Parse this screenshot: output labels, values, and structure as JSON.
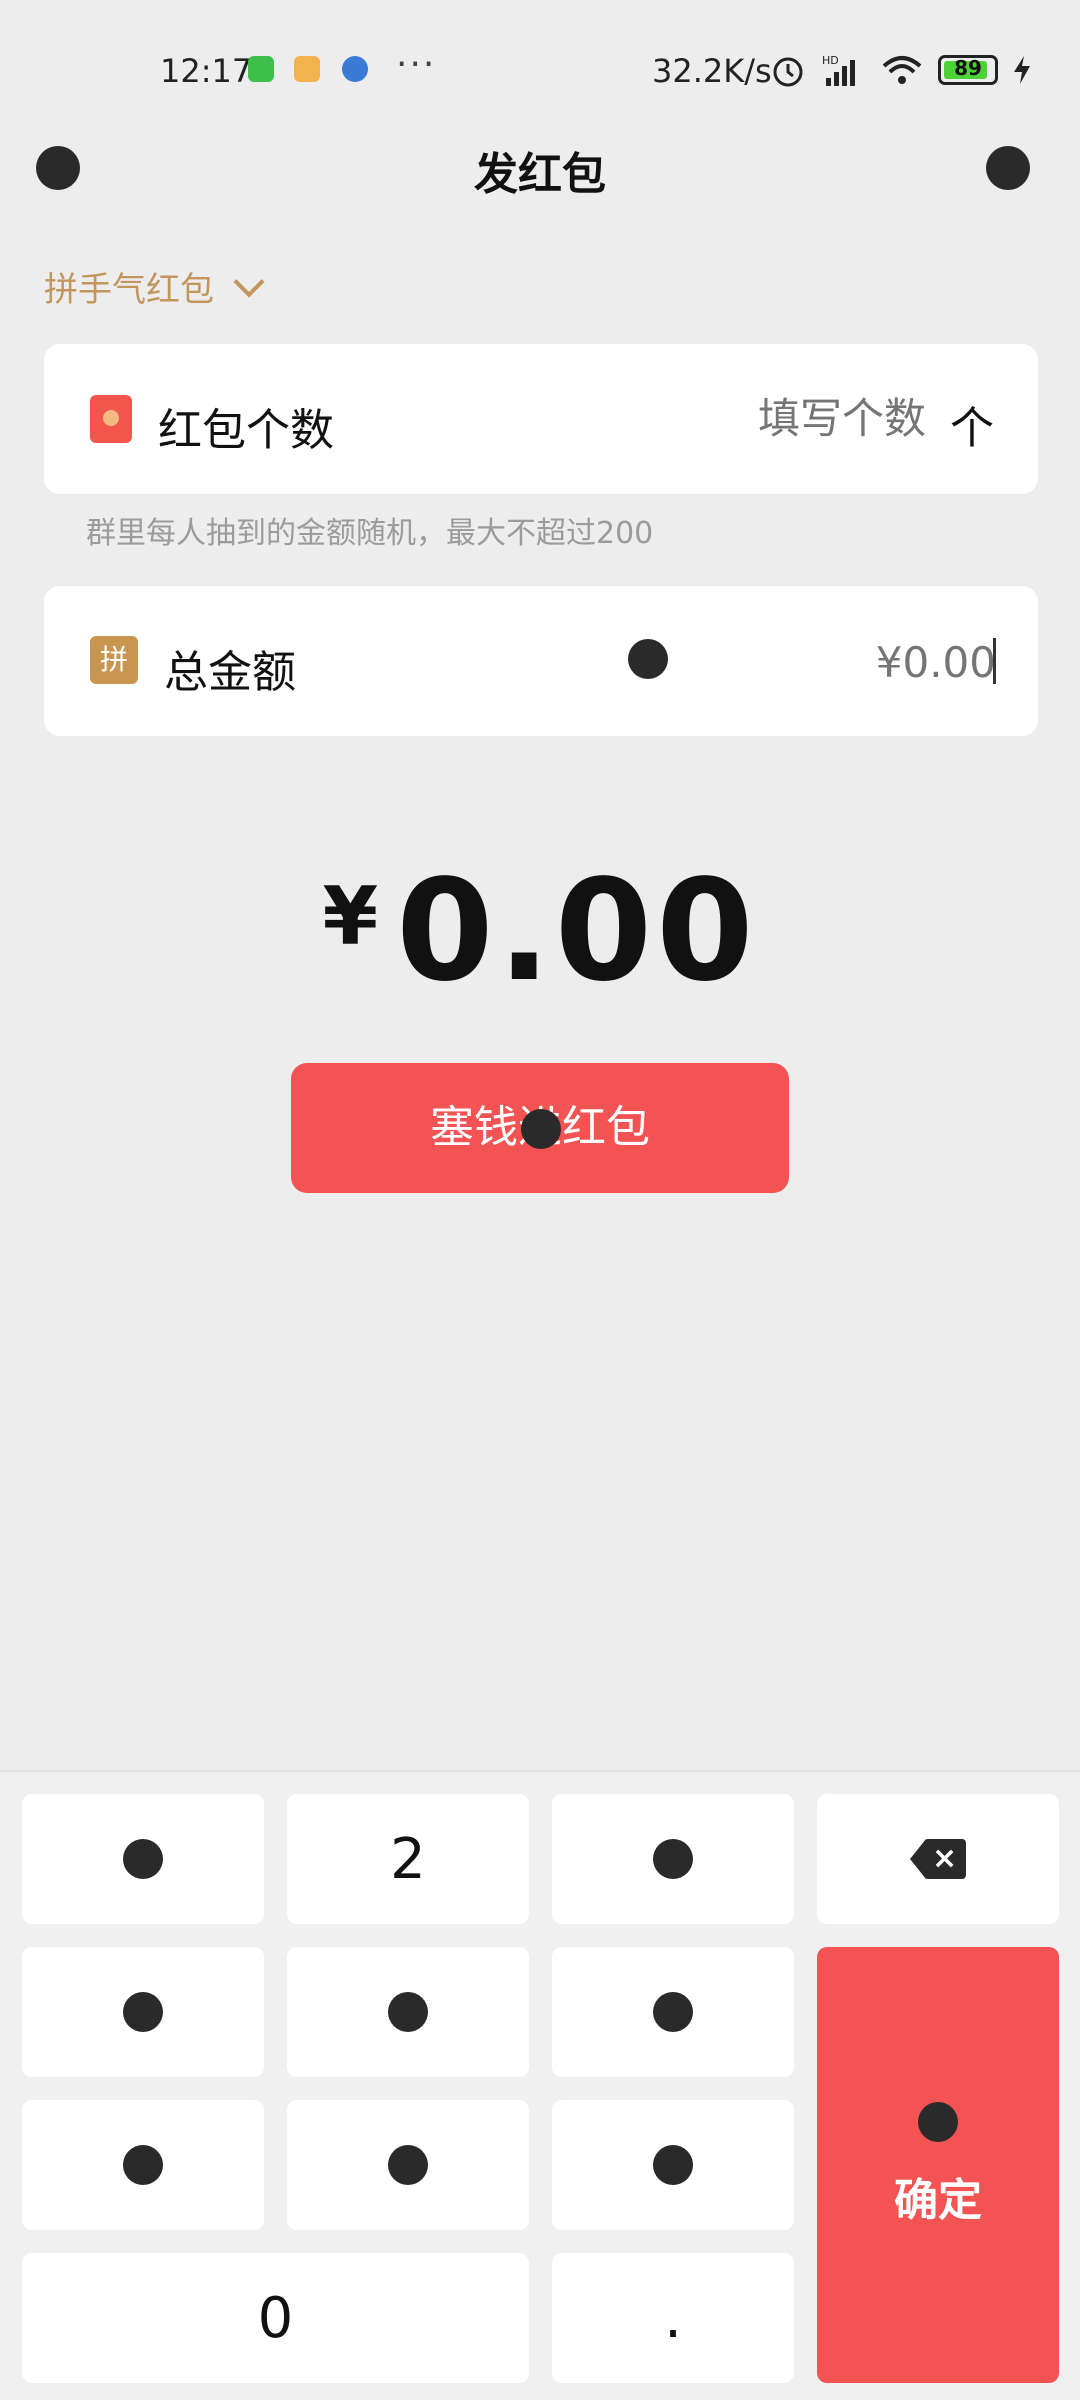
{
  "status_bar": {
    "time": "12:17",
    "more": "···",
    "net_speed": "32.2K/s",
    "battery": "89",
    "colors": {
      "battery_fill": "#4cd137"
    }
  },
  "nav": {
    "title": "发红包",
    "back_icon": "back-icon",
    "more_icon": "more-icon"
  },
  "packet_type": {
    "label": "拼手气红包",
    "icon": "chevron-down-icon"
  },
  "count_card": {
    "icon": "red-packet-icon",
    "label": "红包个数",
    "placeholder": "填写个数",
    "unit": "个"
  },
  "hint": "群里每人抽到的金额随机，最大不超过200",
  "amount_card": {
    "badge": "拼",
    "label": "总金额",
    "placeholder": "¥0.00"
  },
  "total": {
    "currency": "¥",
    "value": "0.00"
  },
  "submit_button": "塞钱进红包",
  "keypad": {
    "keys": [
      "",
      "2",
      "",
      "",
      "",
      "",
      "",
      "",
      "0",
      "."
    ],
    "confirm_label": "确定",
    "backspace_icon": "backspace-icon"
  },
  "colors": {
    "accent_red": "#f45353",
    "gold": "#c3965d",
    "background": "#ededed"
  }
}
